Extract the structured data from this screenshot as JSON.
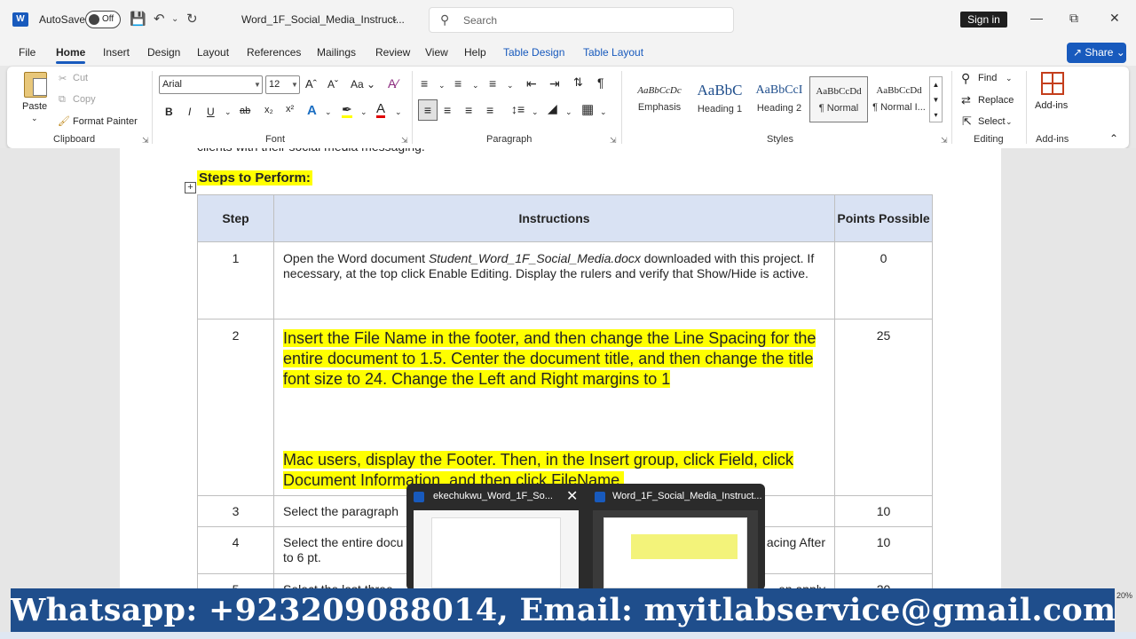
{
  "app": {
    "autosave_label": "AutoSave",
    "autosave_state": "Off",
    "document_title": "Word_1F_Social_Media_Instruct...",
    "search_placeholder": "Search",
    "sign_in": "Sign in",
    "share": "Share"
  },
  "menu": {
    "tabs": [
      "File",
      "Home",
      "Insert",
      "Design",
      "Layout",
      "References",
      "Mailings",
      "Review",
      "View",
      "Help",
      "Table Design",
      "Table Layout"
    ],
    "active": "Home"
  },
  "ribbon": {
    "clipboard": {
      "paste": "Paste",
      "cut": "Cut",
      "copy": "Copy",
      "format_painter": "Format Painter",
      "label": "Clipboard"
    },
    "font": {
      "name": "Arial",
      "size": "12",
      "label": "Font",
      "case_btn": "Aa"
    },
    "paragraph": {
      "label": "Paragraph"
    },
    "styles": {
      "label": "Styles",
      "items": [
        {
          "sample": "AaBbCcDc",
          "name": "Emphasis"
        },
        {
          "sample": "AaBbC",
          "name": "Heading 1"
        },
        {
          "sample": "AaBbCcI",
          "name": "Heading 2"
        },
        {
          "sample": "AaBbCcDd",
          "name": "¶ Normal"
        },
        {
          "sample": "AaBbCcDd",
          "name": "¶ Normal I..."
        }
      ]
    },
    "editing": {
      "find": "Find",
      "replace": "Replace",
      "select": "Select",
      "label": "Editing"
    },
    "addins": {
      "button": "Add-ins",
      "label": "Add-ins"
    }
  },
  "document": {
    "cut_off_line": "clients with their social media messaging.",
    "steps_heading": "Steps to Perform:",
    "table": {
      "headers": [
        "Step",
        "Instructions",
        "Points Possible"
      ],
      "rows": [
        {
          "step": "1",
          "pre": "Open the Word document ",
          "italic": "Student_Word_1F_Social_Media.docx",
          "post": " downloaded with this project. If necessary, at the top click Enable Editing. Display the rulers and verify that Show/Hide is active.",
          "points": "0"
        },
        {
          "step": "2",
          "text_a": "Insert the File Name in the footer, and then change the Line Spacing for the entire document to 1.5. Center the document title, and then change the title font size to 24. Change the Left and Right margins to 1",
          "text_b": "Mac users, display the Footer. Then, in the Insert group, click Field, click Document Information, and then click FileName.",
          "points": "25"
        },
        {
          "step": "3",
          "text": "Select the paragraph",
          "points": "10"
        },
        {
          "step": "4",
          "text_start": "Select the entire docu",
          "text_end": "acing After",
          "text_line2": "to 6 pt.",
          "points": "10"
        },
        {
          "step": "5",
          "text_start": "Select the last three",
          "text_end": "en apply",
          "points": "20"
        }
      ]
    }
  },
  "taskbar_popup": {
    "items": [
      {
        "title": "ekechukwu_Word_1F_So..."
      },
      {
        "title": "Word_1F_Social_Media_Instruct..."
      }
    ]
  },
  "watermark": "Whatsapp: +923209088014, Email: myitlabservice@gmail.com",
  "zoom": "20%"
}
